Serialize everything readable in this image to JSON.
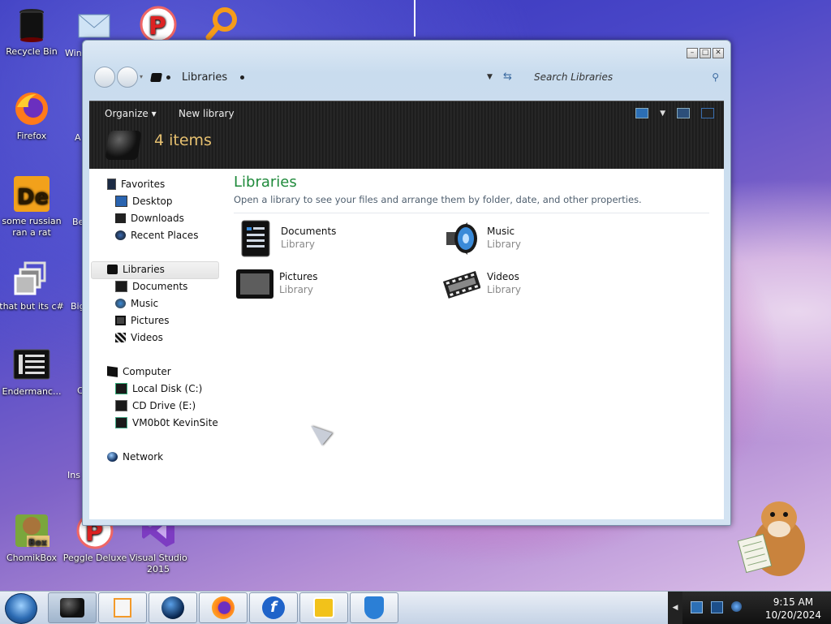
{
  "desktop": {
    "icons": [
      {
        "label": "Recycle Bin"
      },
      {
        "label": "Firefox"
      },
      {
        "label": "some russian ran a rat"
      },
      {
        "label": "that but its c#"
      },
      {
        "label": "Endermanc..."
      },
      {
        "label": "ChomikBox"
      },
      {
        "label": "Peggle Deluxe"
      },
      {
        "label": "Visual Studio 2015"
      }
    ],
    "clipped_labels": [
      "Win",
      "A",
      "Be",
      "Big",
      "C",
      "Ins"
    ]
  },
  "window": {
    "address": {
      "location": "Libraries"
    },
    "search": {
      "placeholder": "Search Libraries"
    },
    "toolbar": {
      "organize_label": "Organize ▾",
      "new_library_label": "New library",
      "item_count": "4 items"
    },
    "nav_tree": {
      "favorites": {
        "label": "Favorites",
        "items": [
          "Desktop",
          "Downloads",
          "Recent Places"
        ]
      },
      "libraries": {
        "label": "Libraries",
        "items": [
          "Documents",
          "Music",
          "Pictures",
          "Videos"
        ]
      },
      "computer": {
        "label": "Computer",
        "items": [
          "Local Disk (C:)",
          "CD Drive (E:)",
          "VM0b0t KevinSite"
        ]
      },
      "network": {
        "label": "Network"
      }
    },
    "content": {
      "title": "Libraries",
      "subtitle": "Open a library to see your files and arrange them by folder, date, and other properties.",
      "libraries": [
        {
          "name": "Documents",
          "type": "Library",
          "icon": "documents-library-icon"
        },
        {
          "name": "Music",
          "type": "Library",
          "icon": "music-library-icon"
        },
        {
          "name": "Pictures",
          "type": "Library",
          "icon": "pictures-library-icon"
        },
        {
          "name": "Videos",
          "type": "Library",
          "icon": "videos-library-icon"
        }
      ]
    }
  },
  "taskbar": {
    "clock": {
      "time": "9:15 AM",
      "date": "10/20/2024"
    }
  },
  "colors": {
    "accent_green": "#1f8a3b",
    "item_count_gold": "#e6c070",
    "toolbar_dark": "#1d1d1d"
  }
}
